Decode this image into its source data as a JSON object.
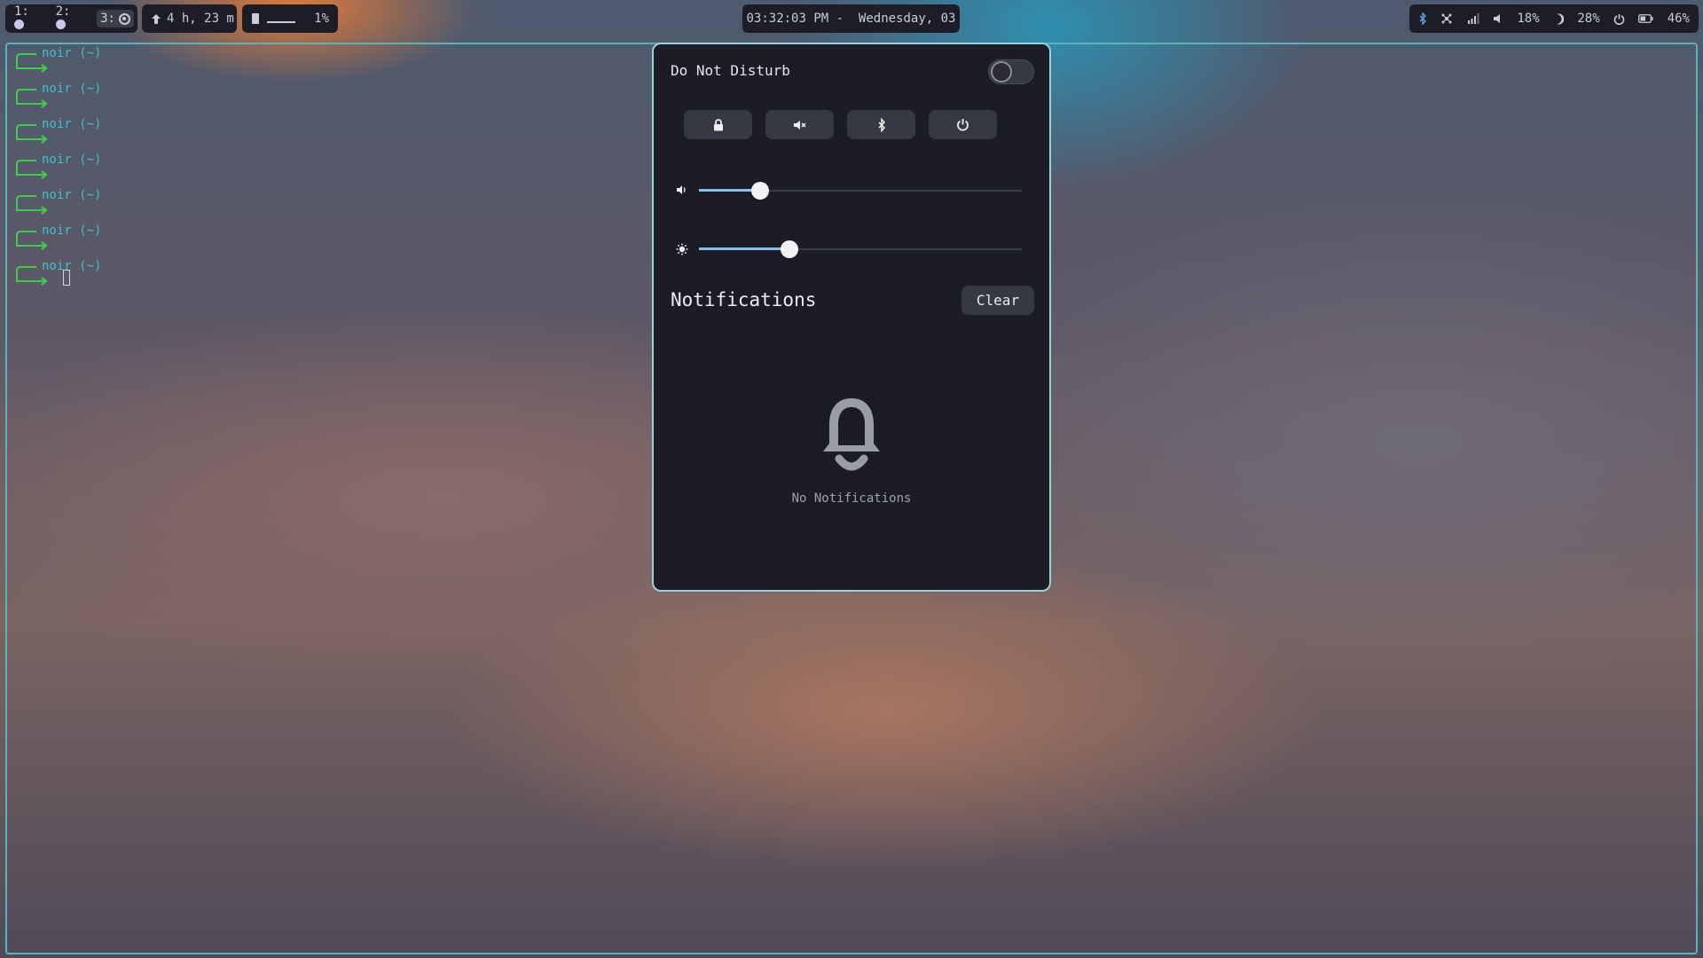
{
  "topbar": {
    "workspaces": [
      {
        "label": "1:"
      },
      {
        "label": "2:"
      },
      {
        "label": "3:"
      }
    ],
    "uptime": "4 h, 23 m",
    "media_percent": "1%",
    "clock": "03:32:03 PM -  Wednesday, 03",
    "status": {
      "volume": "18%",
      "brightness": "28%",
      "battery": "46%"
    }
  },
  "terminal": {
    "prompt_text": "noir (~)",
    "prompts": [
      "noir (~)",
      "noir (~)",
      "noir (~)",
      "noir (~)",
      "noir (~)",
      "noir (~)",
      "noir (~)"
    ]
  },
  "panel": {
    "dnd_label": "Do Not Disturb",
    "dnd_enabled": false,
    "quick_buttons": [
      {
        "icon": "lock-icon"
      },
      {
        "icon": "mute-icon"
      },
      {
        "icon": "bluetooth-icon"
      },
      {
        "icon": "power-icon"
      }
    ],
    "volume_level": 0.19,
    "brightness_level": 0.28,
    "notifications_title": "Notifications",
    "clear_label": "Clear",
    "empty_text": "No Notifications"
  },
  "colors": {
    "accent": "#88bfe8",
    "border": "#9ad0da",
    "prompt_user": "#3ec0c6",
    "prompt_arrow": "#3ecf4a"
  }
}
